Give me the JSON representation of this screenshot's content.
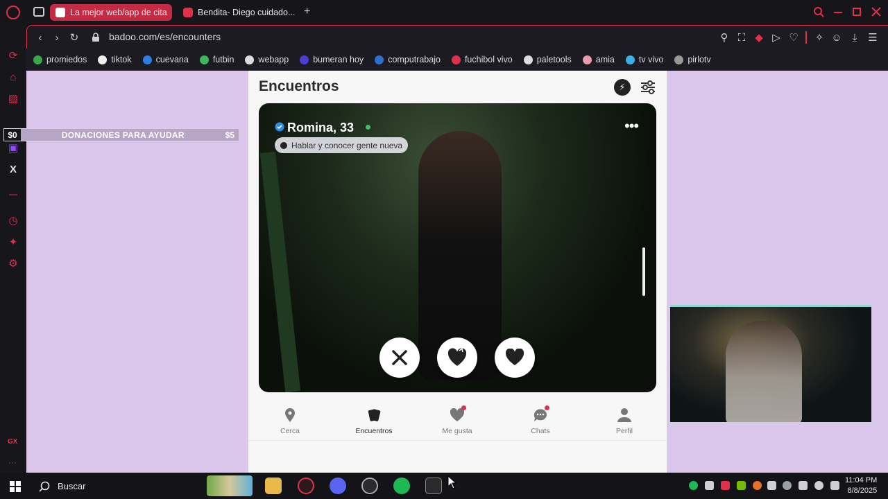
{
  "browser": {
    "tabs": [
      {
        "label": "La mejor web/app de cita",
        "active": true
      },
      {
        "label": "Bendita- Diego cuidado...",
        "active": false
      }
    ],
    "new_tab": "+",
    "url": "badoo.com/es/encounters",
    "sidebar_footer": "GX",
    "sidebar_more": "···"
  },
  "bookmarks": [
    {
      "label": "promiedos",
      "color": "#3aa84b"
    },
    {
      "label": "tiktok",
      "color": "#eeeeee"
    },
    {
      "label": "cuevana",
      "color": "#2d7ee0"
    },
    {
      "label": "futbin",
      "color": "#3db55b"
    },
    {
      "label": "webapp",
      "color": "#dddddd"
    },
    {
      "label": "bumeran hoy",
      "color": "#4a3ed6"
    },
    {
      "label": "computrabajo",
      "color": "#2f6fd0"
    },
    {
      "label": "fuchibol vivo",
      "color": "#e0304e"
    },
    {
      "label": "paletools",
      "color": "#dddddd"
    },
    {
      "label": "amia",
      "color": "#e89ab0"
    },
    {
      "label": "tv vivo",
      "color": "#3bb0e6"
    },
    {
      "label": "pirlotv",
      "color": "#999999"
    }
  ],
  "donation": {
    "min": "$0",
    "label": "DONACIONES PARA AYUDAR",
    "max": "$5"
  },
  "encounters": {
    "title": "Encuentros",
    "profile": {
      "name": "Romina, 33",
      "status": "Hablar y conocer gente nueva"
    },
    "actions": [
      "dislike",
      "superlike",
      "like"
    ]
  },
  "bottom_nav": [
    {
      "label": "Cerca",
      "active": false,
      "dot": false
    },
    {
      "label": "Encuentros",
      "active": true,
      "dot": false
    },
    {
      "label": "Me gusta",
      "active": false,
      "dot": true
    },
    {
      "label": "Chats",
      "active": false,
      "dot": true
    },
    {
      "label": "Perfil",
      "active": false,
      "dot": false
    }
  ],
  "taskbar": {
    "search": "Buscar",
    "time": "11:04 PM",
    "date": "8/8/2025"
  },
  "colors": {
    "accent": "#e0304e",
    "page_bg": "#dbc6ec",
    "online": "#40c060"
  }
}
